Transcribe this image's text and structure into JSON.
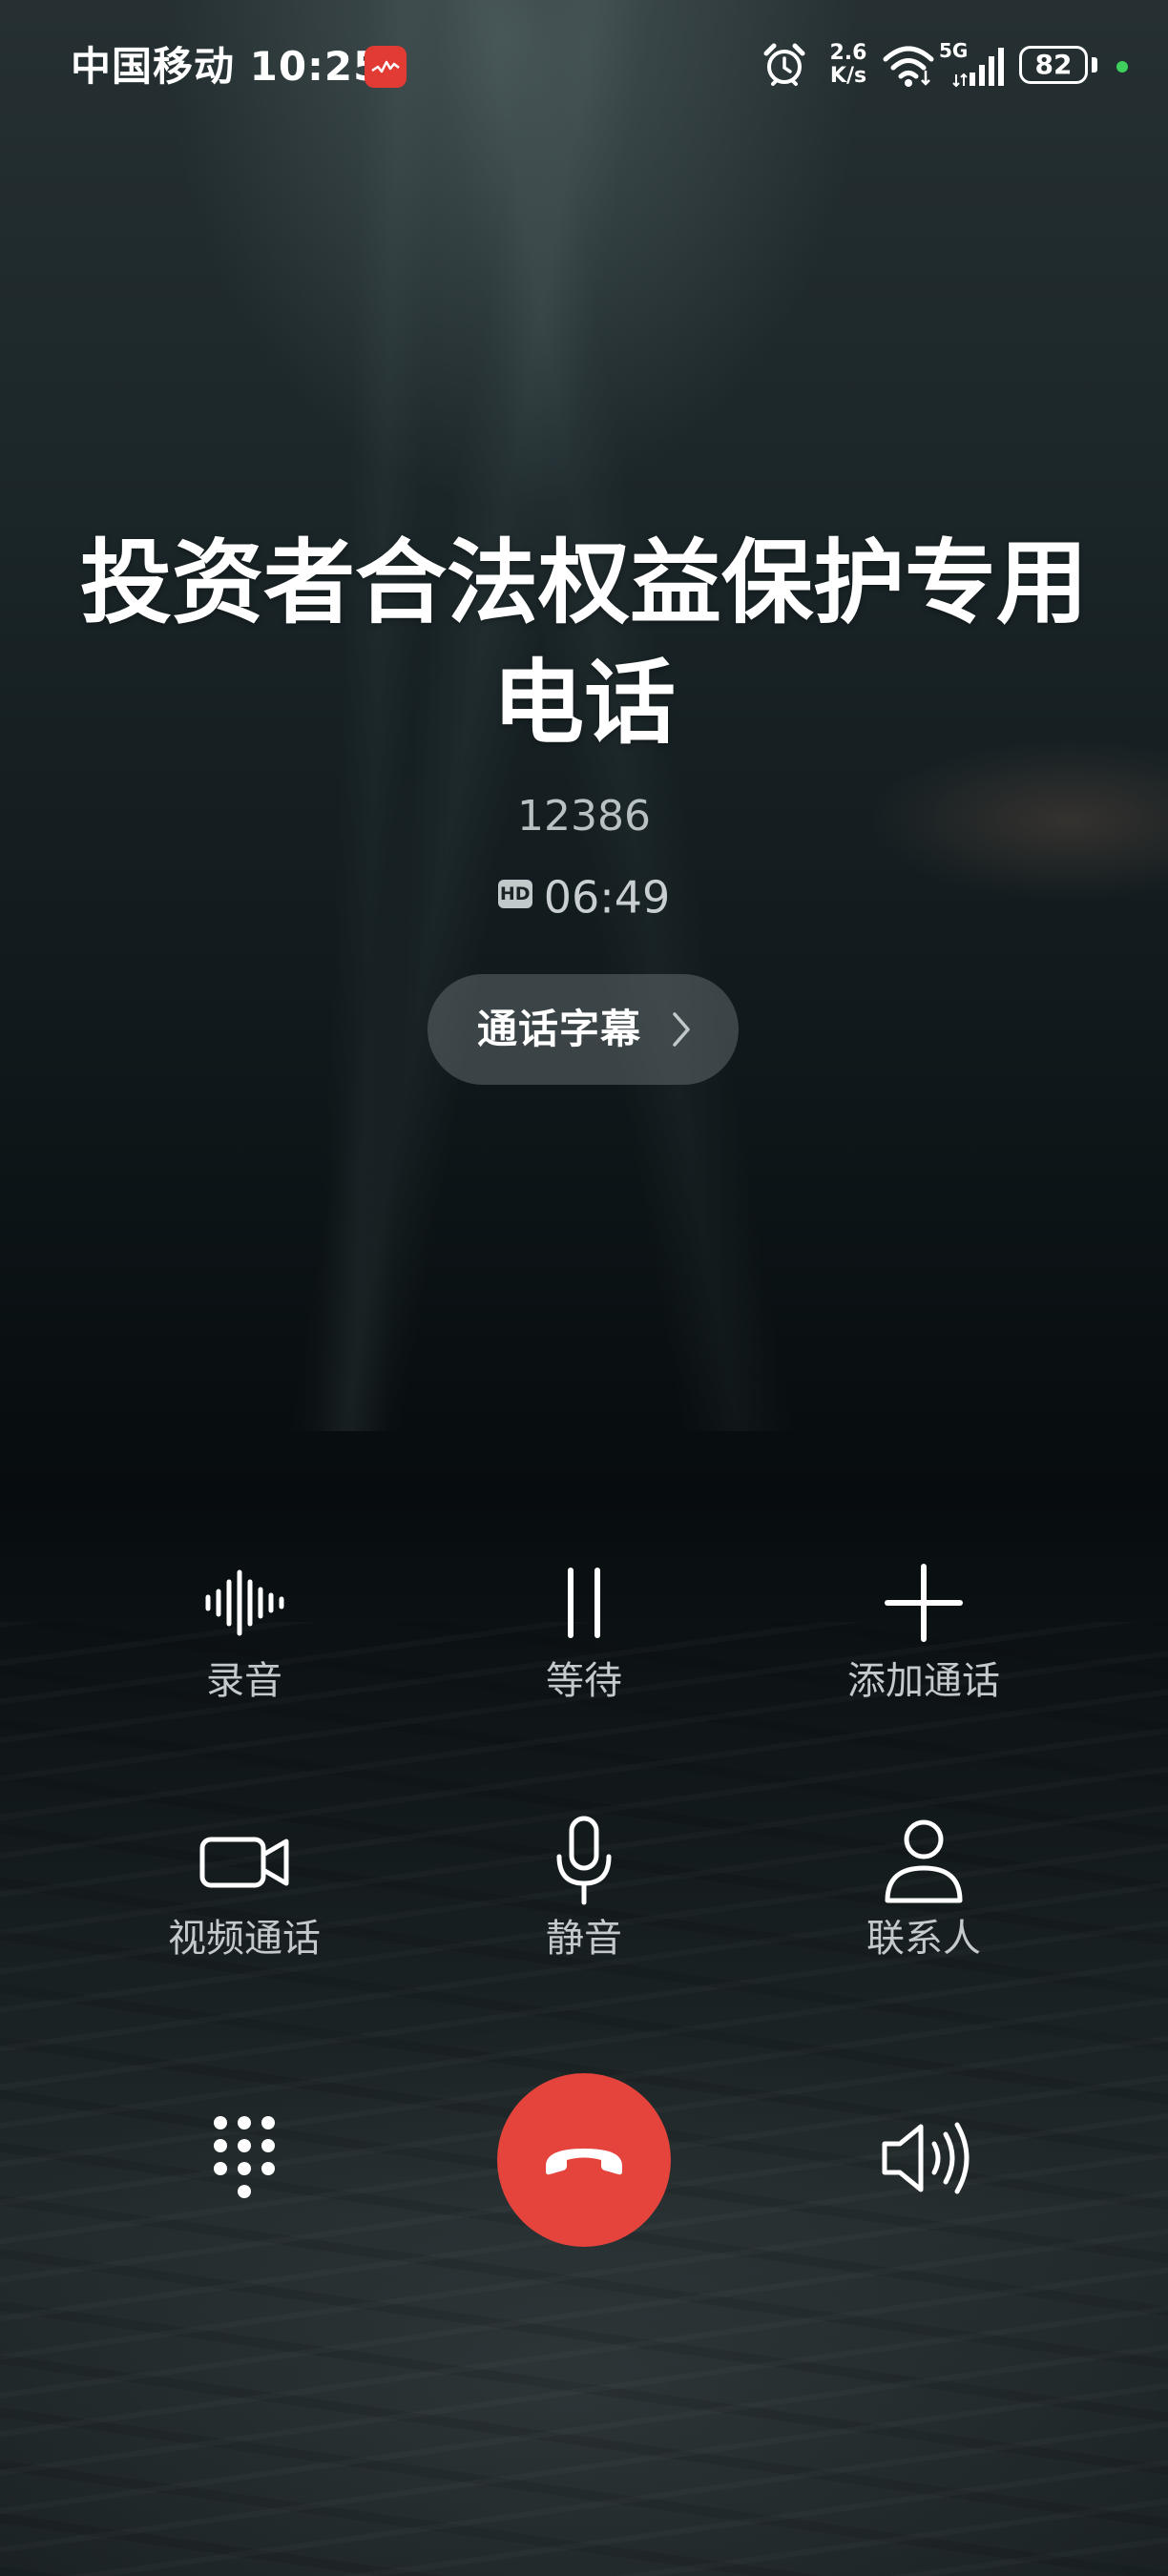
{
  "status_bar": {
    "carrier_time": "中国移动 10:25",
    "net_speed_value": "2.6",
    "net_speed_unit": "K/s",
    "network_type": "5G",
    "battery_level": "82",
    "icons": [
      "app-notification-icon",
      "alarm-icon",
      "wifi-icon",
      "cellular-signal-icon",
      "battery-icon",
      "green-dot-indicator"
    ],
    "colors": {
      "notification_icon": "#e23b33",
      "indicator_dot": "#3ecf5c"
    }
  },
  "call": {
    "name": "投资者合法权益保护专用电话",
    "number": "12386",
    "hd_badge": "HD",
    "duration": "06:49",
    "caption_button": "通话字幕"
  },
  "controls": {
    "record": {
      "label": "录音",
      "icon": "waveform-icon"
    },
    "hold": {
      "label": "等待",
      "icon": "pause-icon"
    },
    "add_call": {
      "label": "添加通话",
      "icon": "plus-icon"
    },
    "video_call": {
      "label": "视频通话",
      "icon": "video-camera-icon"
    },
    "mute": {
      "label": "静音",
      "icon": "microphone-icon"
    },
    "contacts": {
      "label": "联系人",
      "icon": "person-icon"
    }
  },
  "bottom_bar": {
    "dialpad_icon": "dialpad-icon",
    "end_call_icon": "hang-up-icon",
    "speaker_icon": "speaker-icon",
    "end_call_color": "#e5443c"
  }
}
